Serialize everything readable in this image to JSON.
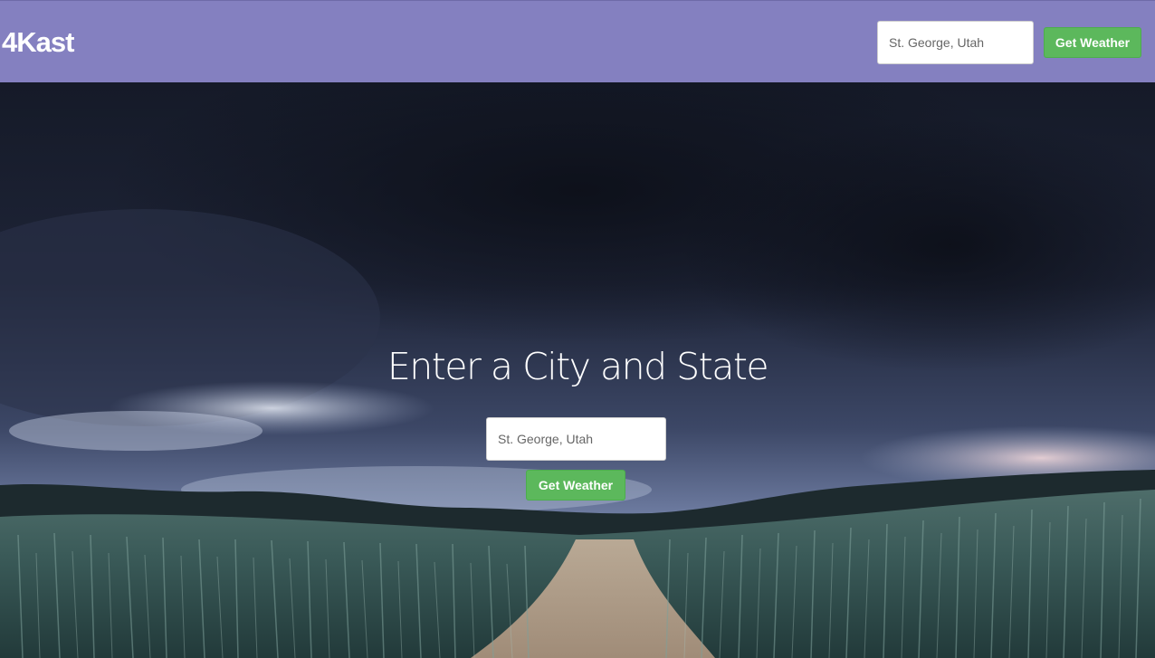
{
  "brand": "4Kast",
  "header": {
    "search_placeholder": "St. George, Utah",
    "button_label": "Get Weather"
  },
  "hero": {
    "title": "Enter a City and State",
    "search_placeholder": "St. George, Utah",
    "button_label": "Get Weather"
  },
  "colors": {
    "navbar": "#8480c0",
    "button": "#5cb85c"
  }
}
